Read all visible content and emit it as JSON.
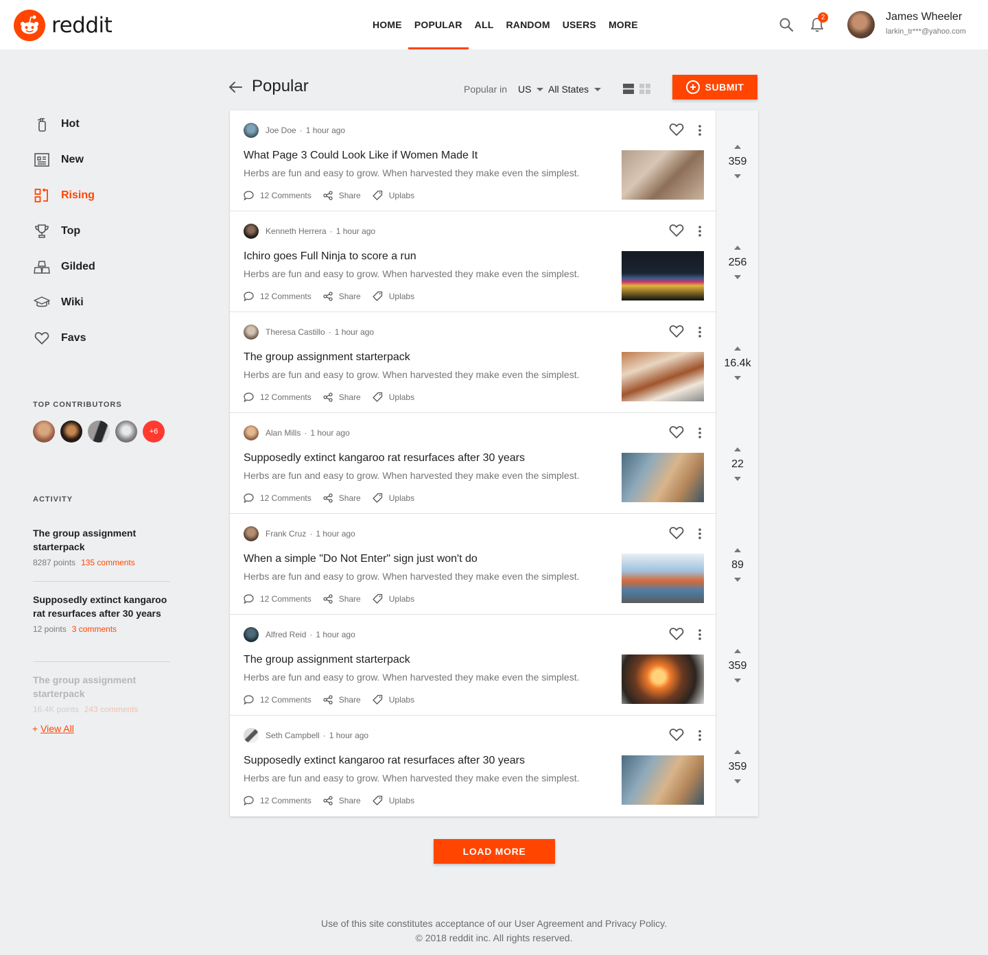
{
  "brand": {
    "name": "reddit",
    "accent": "#ff4500"
  },
  "nav": {
    "items": [
      "HOME",
      "POPULAR",
      "ALL",
      "RANDOM",
      "USERS",
      "MORE"
    ],
    "active": "POPULAR"
  },
  "header": {
    "notifications": "2",
    "user_name": "James Wheeler",
    "user_email": "larkin_tr***@yahoo.com"
  },
  "sidebar": {
    "items": [
      {
        "label": "Hot",
        "icon": "fire-extinguisher-icon"
      },
      {
        "label": "New",
        "icon": "newspaper-icon"
      },
      {
        "label": "Rising",
        "icon": "rising-icon",
        "active": true
      },
      {
        "label": "Top",
        "icon": "trophy-icon"
      },
      {
        "label": "Gilded",
        "icon": "gold-bars-icon"
      },
      {
        "label": "Wiki",
        "icon": "graduation-cap-icon"
      },
      {
        "label": "Favs",
        "icon": "heart-icon"
      }
    ],
    "contributors_title": "TOP CONTRIBUTORS",
    "contributors_more": "+6",
    "activity_title": "ACTIVITY",
    "activity": [
      {
        "title": "The group assignment starterpack",
        "points": "8287 points",
        "comments": "135 comments"
      },
      {
        "title": "Supposedly extinct kangaroo rat resurfaces after 30 years",
        "points": "12 points",
        "comments": "3 comments"
      },
      {
        "title": "The group assignment starterpack",
        "points": "16.4K points",
        "comments": "243 comments"
      }
    ],
    "view_all": "View All",
    "view_all_prefix": "+"
  },
  "main": {
    "title": "Popular",
    "filter_label": "Popular in",
    "country": "US",
    "region": "All States",
    "submit_label": "SUBMIT",
    "load_more": "LOAD MORE"
  },
  "posts": [
    {
      "author": "Joe Doe",
      "time": "1 hour ago",
      "title": "What Page 3 Could Look Like if Women Made It",
      "desc": "Herbs are fun and easy to grow. When harvested they make even the simplest.",
      "comments": "12 Comments",
      "share": "Share",
      "extra": "Uplabs",
      "votes": "359"
    },
    {
      "author": "Kenneth Herrera",
      "time": "1 hour ago",
      "title": "Ichiro goes Full Ninja to score a run",
      "desc": "Herbs are fun and easy to grow. When harvested they make even the simplest.",
      "comments": "12 Comments",
      "share": "Share",
      "extra": "Uplabs",
      "votes": "256"
    },
    {
      "author": "Theresa Castillo",
      "time": "1 hour ago",
      "title": "The group assignment starterpack",
      "desc": "Herbs are fun and easy to grow. When harvested they make even the simplest.",
      "comments": "12 Comments",
      "share": "Share",
      "extra": "Uplabs",
      "votes": "16.4k"
    },
    {
      "author": "Alan Mills",
      "time": "1 hour ago",
      "title": "Supposedly extinct kangaroo rat resurfaces after 30 years",
      "desc": "Herbs are fun and easy to grow. When harvested they make even the simplest.",
      "comments": "12 Comments",
      "share": "Share",
      "extra": "Uplabs",
      "votes": "22"
    },
    {
      "author": "Frank Cruz",
      "time": "1 hour ago",
      "title": "When a simple \"Do Not Enter\" sign just won't do",
      "desc": "Herbs are fun and easy to grow. When harvested they make even the simplest.",
      "comments": "12 Comments",
      "share": "Share",
      "extra": "Uplabs",
      "votes": "89"
    },
    {
      "author": "Alfred Reid",
      "time": "1 hour ago",
      "title": "The group assignment starterpack",
      "desc": "Herbs are fun and easy to grow. When harvested they make even the simplest.",
      "comments": "12 Comments",
      "share": "Share",
      "extra": "Uplabs",
      "votes": "359"
    },
    {
      "author": "Seth Campbell",
      "time": "1 hour ago",
      "title": "Supposedly extinct kangaroo rat resurfaces after 30 years",
      "desc": "Herbs are fun and easy to grow. When harvested they make even the simplest.",
      "comments": "12 Comments",
      "share": "Share",
      "extra": "Uplabs",
      "votes": "359"
    }
  ],
  "footer": {
    "line1": "Use of this site constitutes acceptance of our User Agreement and Privacy Policy.",
    "line2": "© 2018 reddit inc. All rights reserved."
  }
}
